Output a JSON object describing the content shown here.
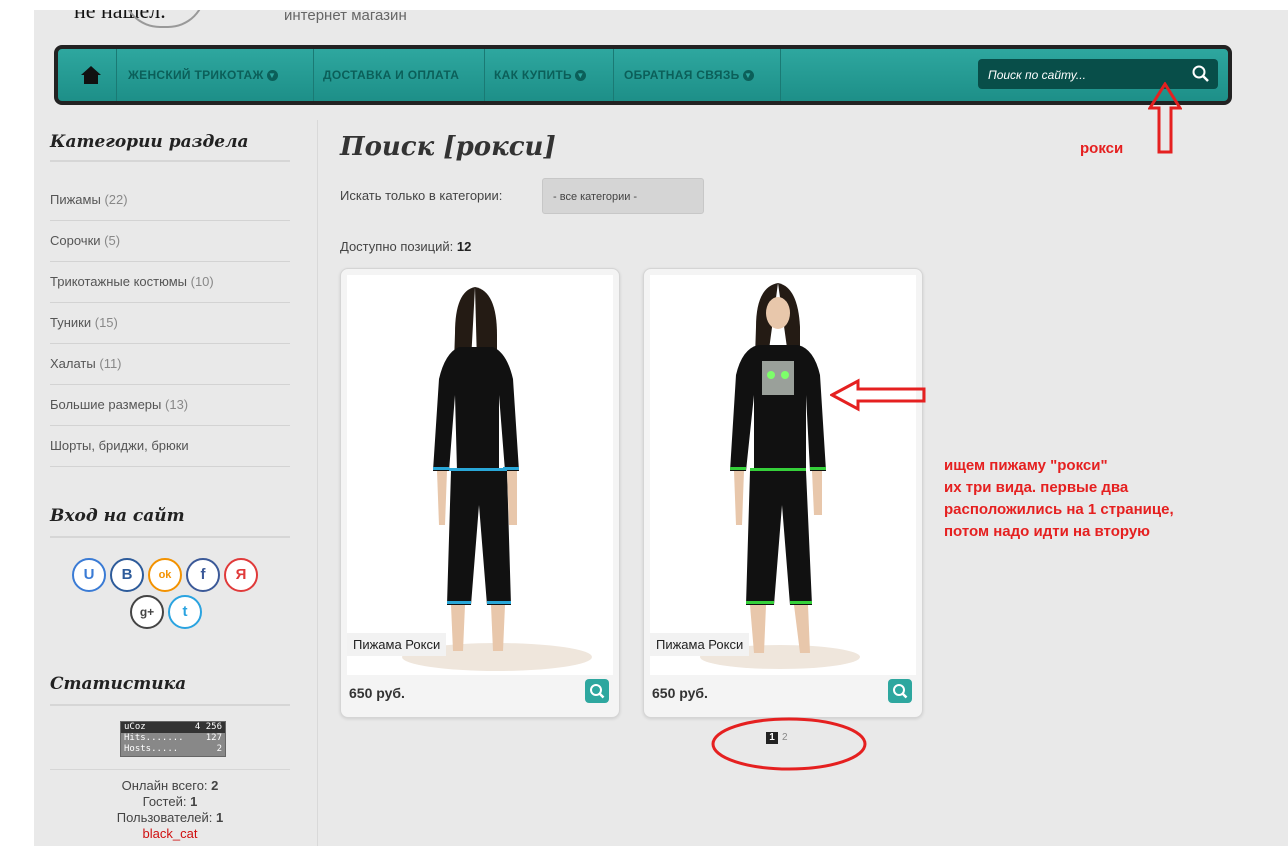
{
  "header": {
    "top_text": "не нашел.",
    "shop_subtitle": "интернет магазин"
  },
  "nav": {
    "items": [
      {
        "label": "ЖЕНСКИЙ ТРИКОТАЖ",
        "has_dropdown": true
      },
      {
        "label": "ДОСТАВКА И ОПЛАТА",
        "has_dropdown": false
      },
      {
        "label": "КАК КУПИТЬ",
        "has_dropdown": true
      },
      {
        "label": "ОБРАТНАЯ СВЯЗЬ",
        "has_dropdown": true
      }
    ],
    "search_placeholder": "Поиск по сайту..."
  },
  "sidebar": {
    "categories_title": "Категории раздела",
    "categories": [
      {
        "name": "Пижамы",
        "count": "(22)"
      },
      {
        "name": "Сорочки",
        "count": "(5)"
      },
      {
        "name": "Трикотажные костюмы",
        "count": "(10)"
      },
      {
        "name": "Туники",
        "count": "(15)"
      },
      {
        "name": "Халаты",
        "count": "(11)"
      },
      {
        "name": "Большие размеры",
        "count": "(13)"
      },
      {
        "name": "Шорты, бриджи, брюки",
        "count": ""
      }
    ],
    "login_title": "Вход на сайт",
    "social": [
      {
        "icon": "ucoz-icon",
        "glyph": "U",
        "color": "#3a7bd5"
      },
      {
        "icon": "vk-icon",
        "glyph": "B",
        "color": "#2d5b9a"
      },
      {
        "icon": "odnoklassniki-icon",
        "glyph": "ok",
        "color": "#f39200"
      },
      {
        "icon": "facebook-icon",
        "glyph": "f",
        "color": "#3b5998"
      },
      {
        "icon": "yandex-icon",
        "glyph": "Я",
        "color": "#e03a3a"
      },
      {
        "icon": "google-plus-icon",
        "glyph": "g+",
        "color": "#444444"
      },
      {
        "icon": "twitter-icon",
        "glyph": "t",
        "color": "#2aa3e0"
      }
    ],
    "stats_title": "Статистика",
    "counter": {
      "brand": "uCoz",
      "total": "4 256",
      "hits_label": "Hits.......",
      "hits": "127",
      "hosts_label": "Hosts.....",
      "hosts": "2"
    },
    "online_label": "Онлайн всего:",
    "online_value": "2",
    "guests_label": "Гостей:",
    "guests_value": "1",
    "users_label": "Пользователей:",
    "users_value": "1",
    "user_name": "black_cat"
  },
  "main": {
    "title": "Поиск [рокси]",
    "filter_label": "Искать только в категории:",
    "filter_value": "- все категории -",
    "available_label": "Доступно позиций:",
    "available_count": "12",
    "products": [
      {
        "name": "Пижама Рокси",
        "price": "650 руб."
      },
      {
        "name": "Пижама Рокси",
        "price": "650 руб."
      }
    ],
    "pagination": {
      "current": "1",
      "next": "2"
    }
  },
  "annotations": {
    "search_term": "рокси",
    "note": [
      "ищем пижаму \"рокси\"",
      "их три вида. первые два",
      "расположились на 1 странице,",
      "потом надо идти на вторую"
    ]
  }
}
